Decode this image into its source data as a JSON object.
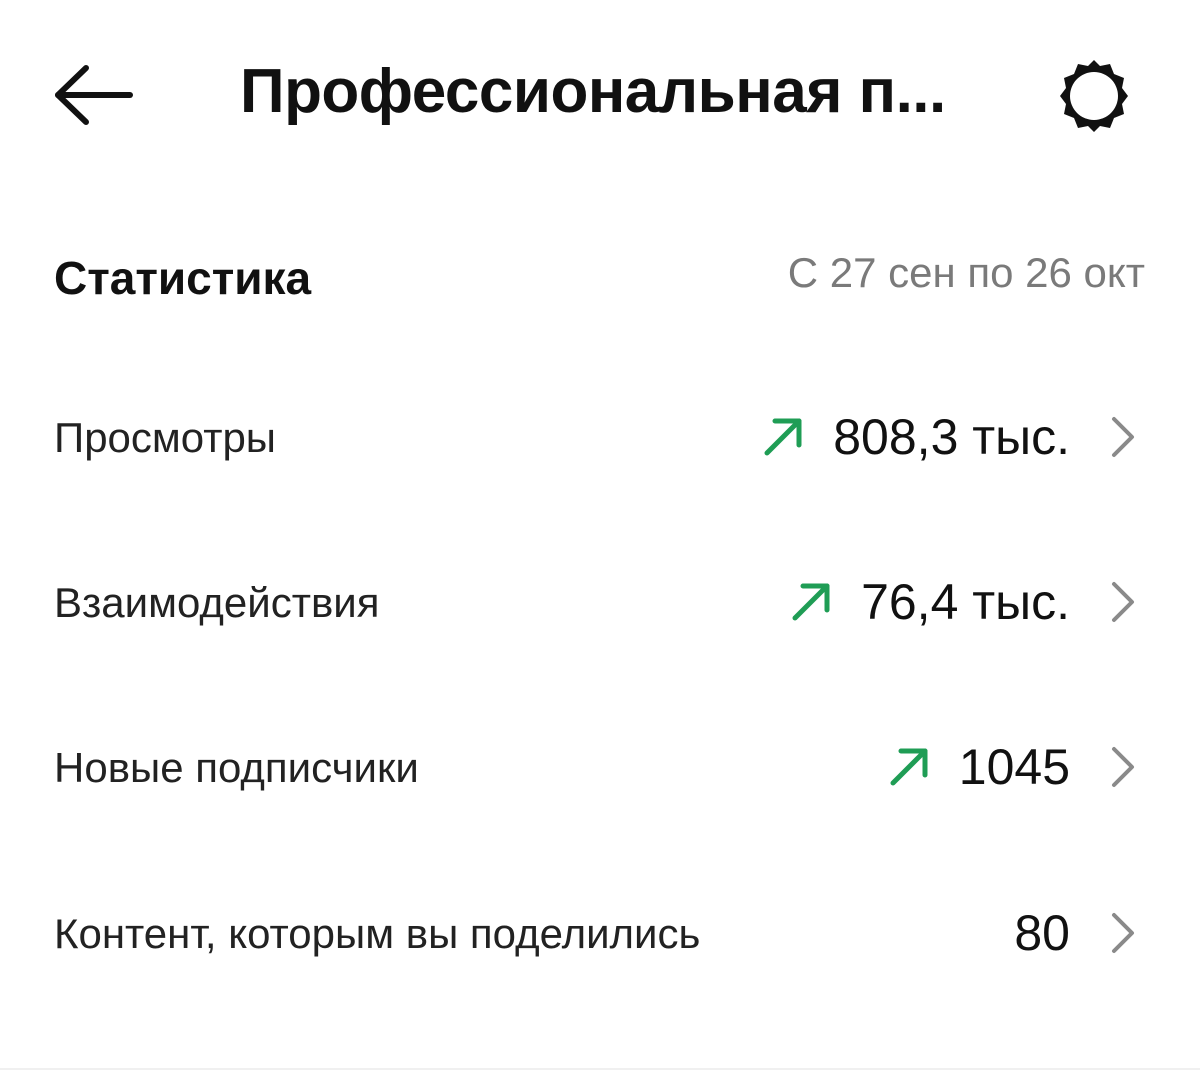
{
  "header": {
    "title": "Профессиональная п...",
    "back_icon": "arrow-left-icon",
    "settings_icon": "gear-icon"
  },
  "stats": {
    "section_title": "Статистика",
    "date_range": "С 27 сен по 26 окт",
    "rows": [
      {
        "label": "Просмотры",
        "value": "808,3 тыс.",
        "trend": "up"
      },
      {
        "label": "Взаимодействия",
        "value": "76,4 тыс.",
        "trend": "up"
      },
      {
        "label": "Новые подписчики",
        "value": "1045",
        "trend": "up"
      },
      {
        "label": "Контент, которым вы поделились",
        "value": "80",
        "trend": "none"
      }
    ]
  },
  "colors": {
    "trend_up": "#1f9d55",
    "muted_text": "#7a7a7a",
    "chevron": "#8a8a8a"
  }
}
